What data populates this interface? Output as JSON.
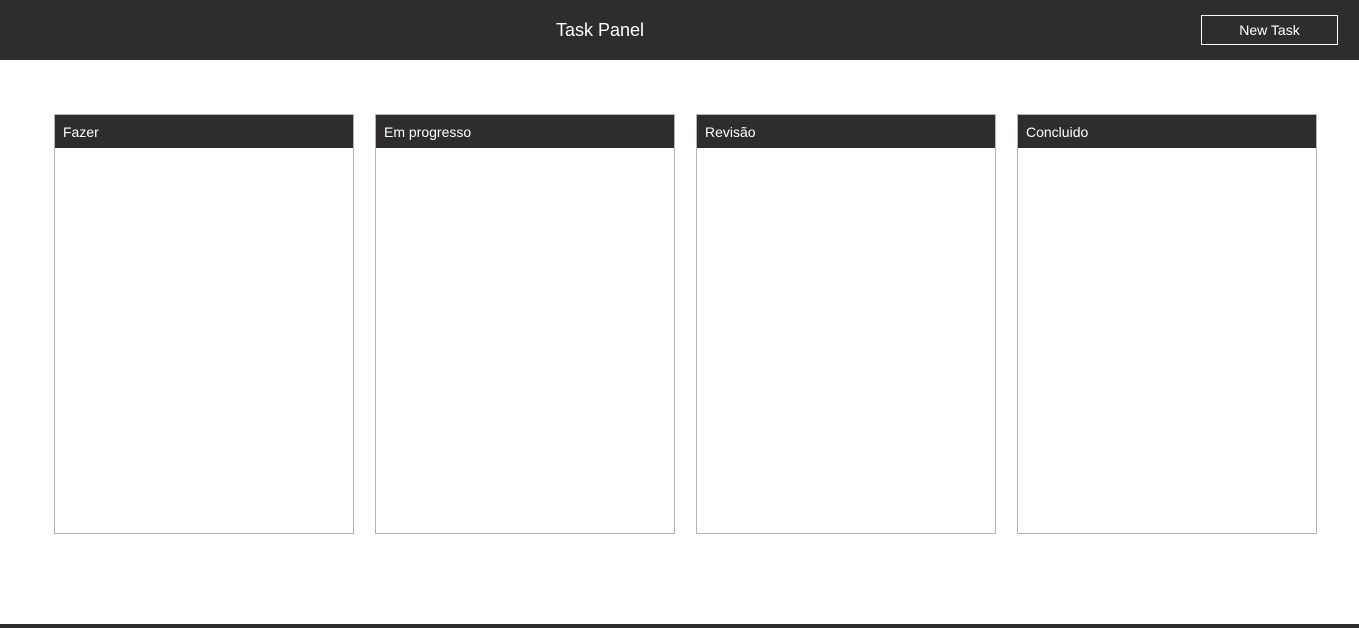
{
  "header": {
    "title": "Task Panel",
    "new_task_label": "New Task"
  },
  "board": {
    "columns": [
      {
        "label": "Fazer"
      },
      {
        "label": "Em progresso"
      },
      {
        "label": "Revisão"
      },
      {
        "label": "Concluido"
      }
    ]
  },
  "colors": {
    "header_bg": "#2f2c2d",
    "column_border": "#b5b5b5",
    "text_on_dark": "#ffffff"
  }
}
